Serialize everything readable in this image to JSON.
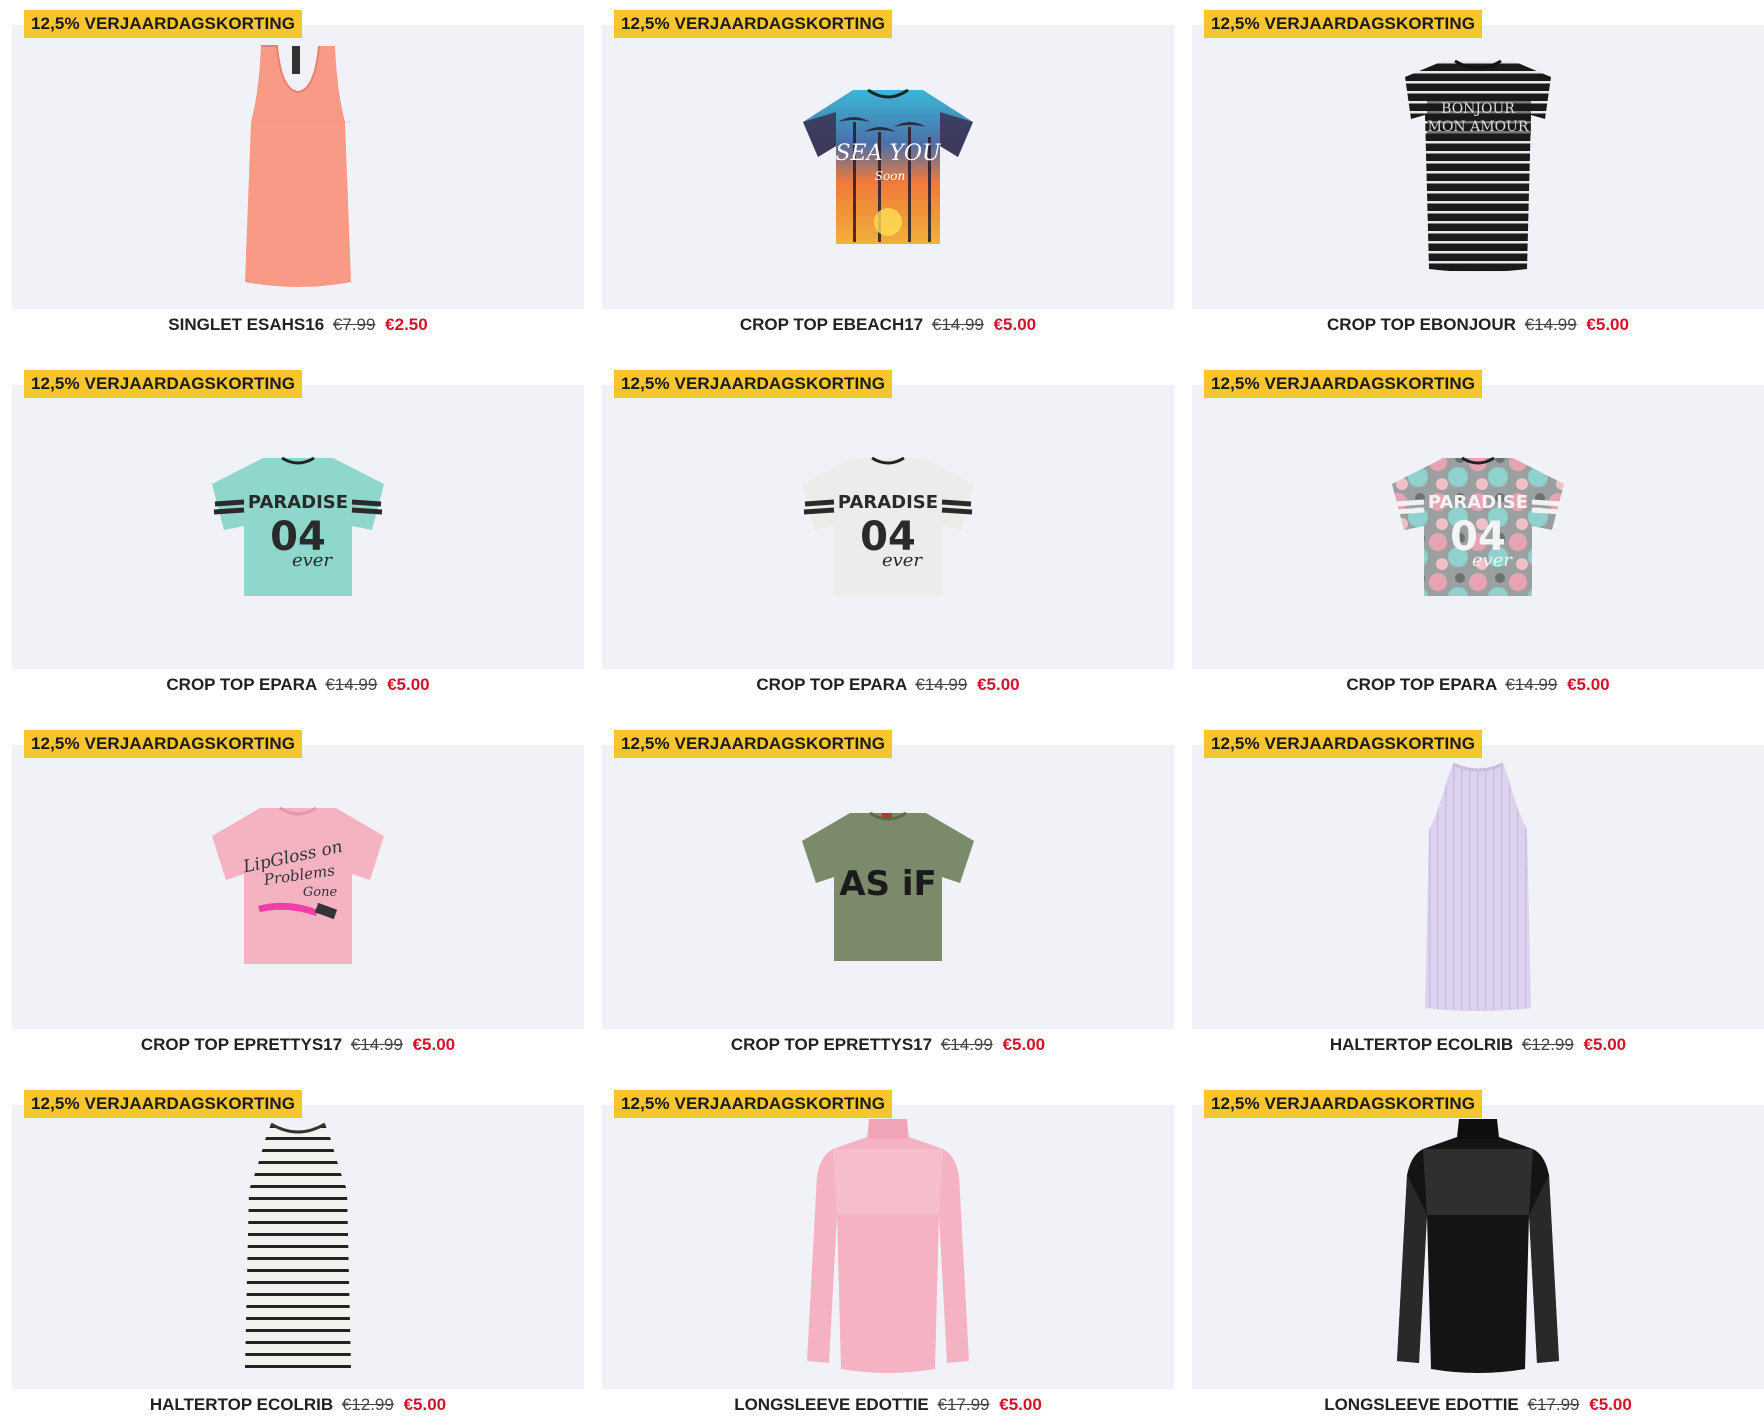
{
  "badge_text": "12,5% VERJAARDAGSKORTING",
  "colors": {
    "badge": "#f7c52c",
    "sale_price": "#d4132b",
    "card_bg": "#f1f2f7"
  },
  "products": [
    {
      "name": "SINGLET ESAHS16",
      "old_price": "€7.99",
      "price": "€2.50",
      "image": "coral-singlet"
    },
    {
      "name": "CROP TOP EBEACH17",
      "old_price": "€14.99",
      "price": "€5.00",
      "image": "sunset-palm-crop-top"
    },
    {
      "name": "CROP TOP EBONJOUR",
      "old_price": "€14.99",
      "price": "€5.00",
      "image": "striped-bonjour-top"
    },
    {
      "name": "CROP TOP EPARA",
      "old_price": "€14.99",
      "price": "€5.00",
      "image": "mint-paradise-crop-top"
    },
    {
      "name": "CROP TOP EPARA",
      "old_price": "€14.99",
      "price": "€5.00",
      "image": "white-paradise-crop-top"
    },
    {
      "name": "CROP TOP EPARA",
      "old_price": "€14.99",
      "price": "€5.00",
      "image": "floral-paradise-crop-top"
    },
    {
      "name": "CROP TOP EPRETTYS17",
      "old_price": "€14.99",
      "price": "€5.00",
      "image": "pink-lipgloss-crop-top"
    },
    {
      "name": "CROP TOP EPRETTYS17",
      "old_price": "€14.99",
      "price": "€5.00",
      "image": "green-as-if-crop-top"
    },
    {
      "name": "HALTERTOP ECOLRIB",
      "old_price": "€12.99",
      "price": "€5.00",
      "image": "lilac-haltertop"
    },
    {
      "name": "HALTERTOP ECOLRIB",
      "old_price": "€12.99",
      "price": "€5.00",
      "image": "striped-haltertop"
    },
    {
      "name": "LONGSLEEVE EDOTTIE",
      "old_price": "€17.99",
      "price": "€5.00",
      "image": "pink-longsleeve"
    },
    {
      "name": "LONGSLEEVE EDOTTIE",
      "old_price": "€17.99",
      "price": "€5.00",
      "image": "black-longsleeve"
    }
  ],
  "print_text": {
    "sea_you": "SEA YOU",
    "soon": "Soon",
    "bonjour": "BONJOUR",
    "mon_amour": "MON AMOUR",
    "paradise": "PARADISE",
    "number": "04",
    "ever": "ever",
    "lipgloss_1": "LipGloss on",
    "lipgloss_2": "Problems",
    "lipgloss_3": "Gone",
    "as_if": "AS iF"
  }
}
